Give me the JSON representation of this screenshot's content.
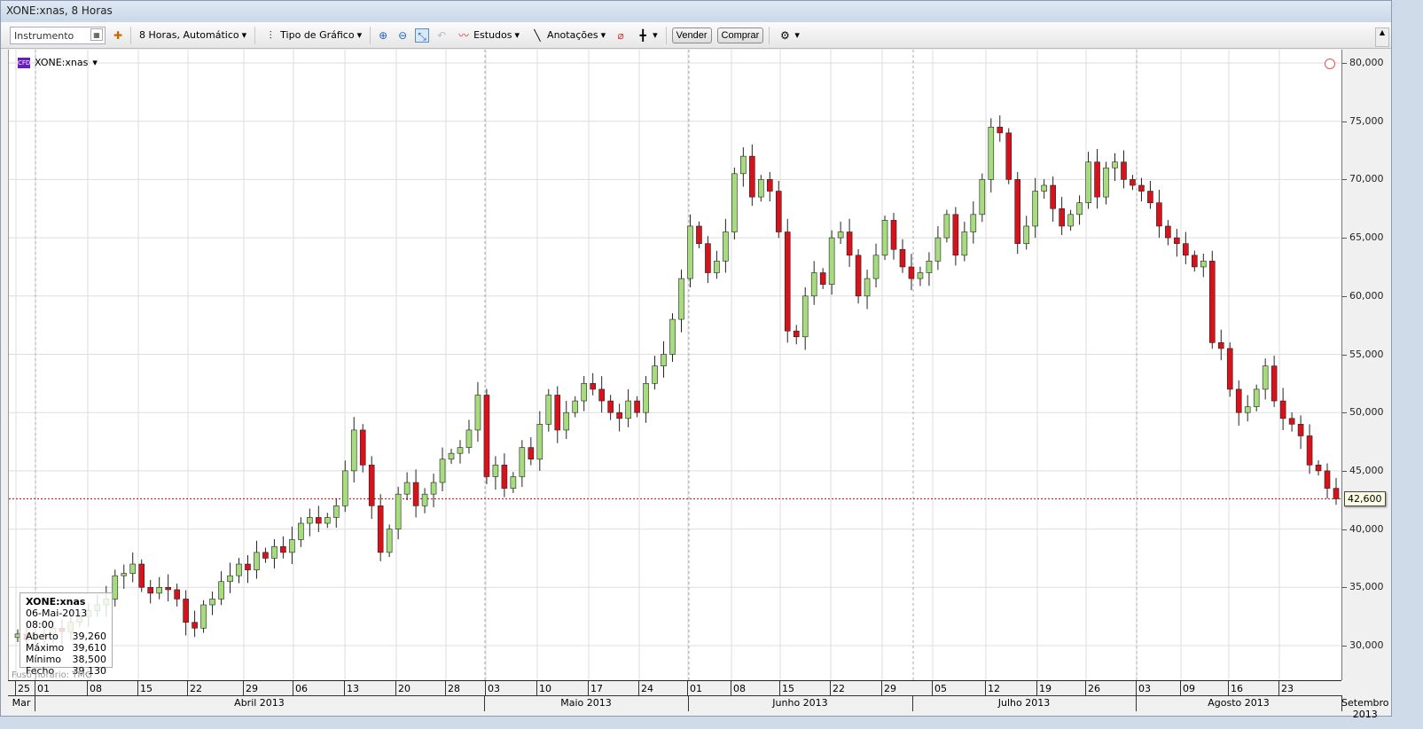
{
  "window": {
    "title": "XONE:xnas, 8 Horas"
  },
  "toolbar": {
    "instrument_placeholder": "Instrumento",
    "interval": "8 Horas,  Automático",
    "chart_type": "Tipo de Gráfico",
    "studies": "Estudos",
    "annotations": "Anotações",
    "sell": "Vender",
    "buy": "Comprar"
  },
  "legend": {
    "badge": "CFD",
    "symbol": "XONE:xnas"
  },
  "tooltip": {
    "symbol": "XONE:xnas",
    "datetime": "06-Mai-2013 08:00",
    "rows": [
      {
        "k": "Aberto",
        "v": "39,260"
      },
      {
        "k": "Máximo",
        "v": "39,610"
      },
      {
        "k": "Mínimo",
        "v": "38,500"
      },
      {
        "k": "Fecho",
        "v": "39,130"
      }
    ]
  },
  "timezone": "Fuso horário: TMG",
  "current_price": "42,600",
  "colors": {
    "up": "#a6dc7e",
    "down": "#d8121b",
    "price_line": "#cc0000"
  },
  "chart_data": {
    "type": "candlestick",
    "y_ticks": [
      "80,000",
      "75,000",
      "70,000",
      "65,000",
      "60,000",
      "55,000",
      "50,000",
      "45,000",
      "40,000",
      "35,000",
      "30,000"
    ],
    "ylim": [
      26000,
      81000
    ],
    "x_ticks": [
      "25",
      "01",
      "08",
      "15",
      "22",
      "29",
      "06",
      "13",
      "20",
      "28",
      "03",
      "10",
      "17",
      "24",
      "01",
      "08",
      "15",
      "22",
      "29",
      "05",
      "12",
      "19",
      "26",
      "03",
      "09",
      "16",
      "23"
    ],
    "months": [
      "Mar",
      "Abril 2013",
      "Maio 2013",
      "Junho 2013",
      "Julho 2013",
      "Agosto 2013",
      "Setembro 2013"
    ],
    "close_thousands": [
      31,
      30.5,
      31,
      30.8,
      31.5,
      31.2,
      32,
      32.5,
      33,
      33.5,
      34,
      36,
      36.2,
      37,
      35,
      34.5,
      35,
      34.8,
      34,
      32,
      31.5,
      33.5,
      34,
      35.5,
      36,
      37,
      36.5,
      38,
      37.5,
      38.5,
      38,
      39.1,
      40.5,
      41,
      40.5,
      41,
      42,
      45,
      48.5,
      45.5,
      42,
      38,
      40,
      43,
      44,
      42,
      43,
      44,
      46,
      46.5,
      47,
      48.5,
      51.5,
      44.5,
      45.5,
      43.5,
      44.5,
      47,
      46,
      49,
      51.5,
      48.5,
      50,
      51,
      52.5,
      52,
      51,
      50,
      49.5,
      51,
      50,
      52.5,
      54,
      55,
      58,
      61.5,
      66,
      64.5,
      62,
      63,
      65.5,
      70.5,
      72,
      68.5,
      70,
      69,
      65.5,
      57,
      56.5,
      60,
      62,
      61,
      65,
      65.5,
      63.5,
      60,
      61.5,
      63.5,
      66.5,
      64,
      62.5,
      61.5,
      62,
      63,
      65,
      67,
      63.5,
      65.5,
      67,
      70,
      74.5,
      74,
      70,
      64.5,
      66,
      69,
      69.5,
      67.5,
      66,
      67,
      68,
      71.5,
      68.5,
      71,
      71.5,
      70,
      69.5,
      69,
      68,
      66,
      65,
      64.5,
      63.5,
      62.5,
      63,
      56,
      55.5,
      52,
      50,
      50.5,
      52,
      54,
      51,
      49.5,
      49,
      48,
      45.5,
      45,
      43.5,
      42.6
    ]
  }
}
